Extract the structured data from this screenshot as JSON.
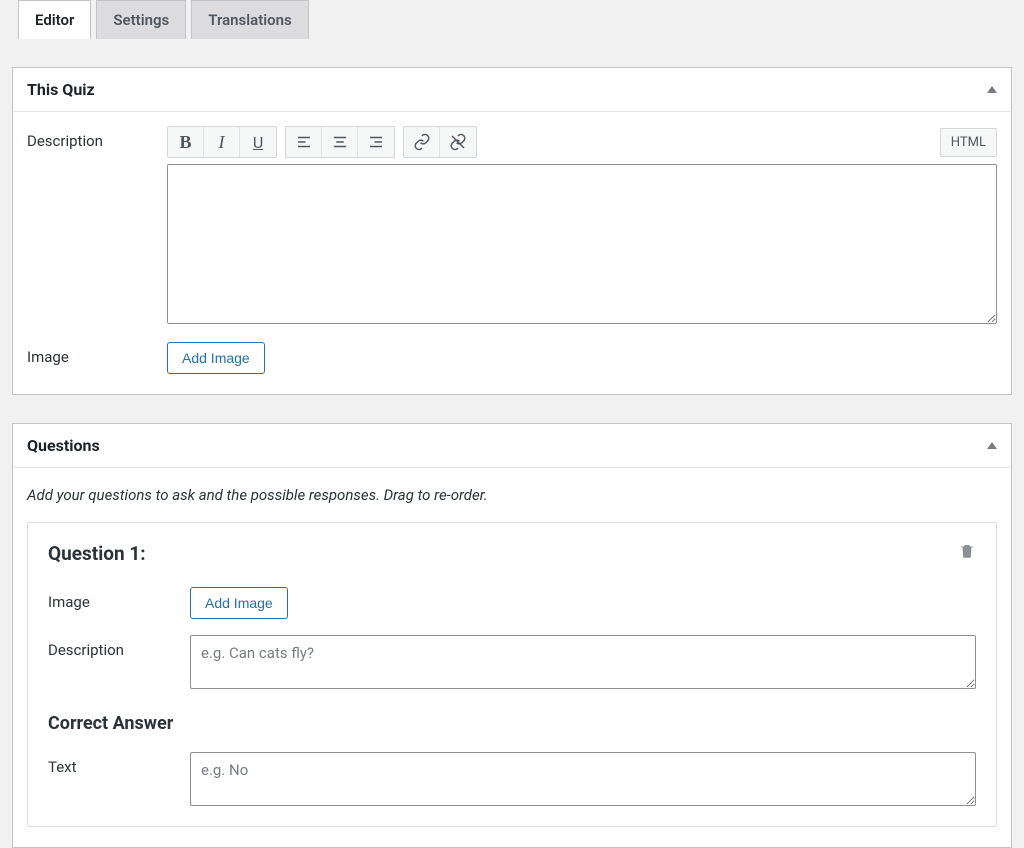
{
  "tabs": {
    "editor": "Editor",
    "settings": "Settings",
    "translations": "Translations"
  },
  "thisQuiz": {
    "title": "This Quiz",
    "descriptionLabel": "Description",
    "htmlButton": "HTML",
    "descriptionValue": "",
    "imageLabel": "Image",
    "addImageButton": "Add Image"
  },
  "questionsPanel": {
    "title": "Questions",
    "hint": "Add your questions to ask and the possible responses. Drag to re-order."
  },
  "question1": {
    "title": "Question 1:",
    "imageLabel": "Image",
    "addImageButton": "Add Image",
    "descriptionLabel": "Description",
    "descriptionPlaceholder": "e.g. Can cats fly?",
    "descriptionValue": "",
    "correctAnswerHeading": "Correct Answer",
    "textLabel": "Text",
    "textPlaceholder": "e.g. No",
    "textValue": ""
  }
}
